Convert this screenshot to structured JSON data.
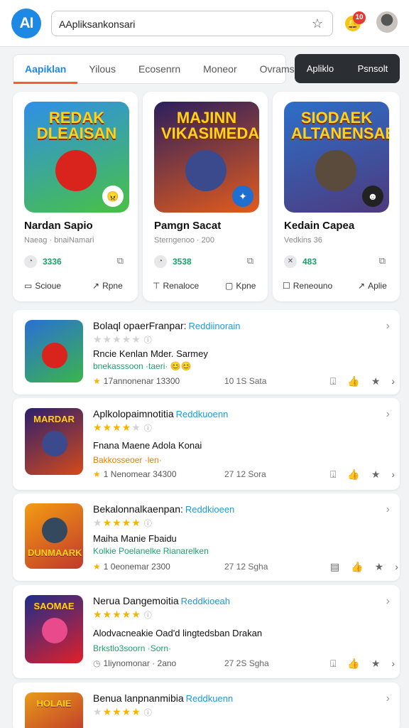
{
  "header": {
    "logo": "AI",
    "search_value": "AApliksankonsari",
    "star_icon": "star-outline-icon",
    "notification_count": "10"
  },
  "tabs": [
    {
      "label": "Aapiklan"
    },
    {
      "label": "Yilous"
    },
    {
      "label": "Ecosenrn"
    },
    {
      "label": "Moneor"
    },
    {
      "label": "Ovrams"
    }
  ],
  "segment": {
    "left": "Apliklo",
    "right": "Psnsolt"
  },
  "featured": [
    {
      "banner": "REDAK DLEAISAN",
      "title": "Nardan Sapio",
      "subtitle": "Naeag  ·  bnaiNamari",
      "stat": "3336",
      "action_left": "Scioue",
      "action_right": "Rpne",
      "colors": {
        "bg1": "#2f8fe8",
        "bg2": "#49c144",
        "hero": "#d9241e"
      }
    },
    {
      "banner": "MAJINN VIKASIMEDAH",
      "title": "Pamgn Sacat",
      "subtitle": "Sterngenoo  ·  200",
      "stat": "3538",
      "action_left": "Renaloce",
      "action_right": "Kpne",
      "colors": {
        "bg1": "#2a1f5e",
        "bg2": "#e35b1c",
        "hero": "#3a4a8c"
      }
    },
    {
      "banner": "SIODAEK ALTANENSAE",
      "title": "Kedain Capea",
      "subtitle": "Vedkins 36",
      "stat": "483",
      "action_left": "Reneouno",
      "action_right": "Aplie",
      "colors": {
        "bg1": "#2c6fc9",
        "bg2": "#4e3a7d",
        "hero": "#5a4b3c"
      }
    }
  ],
  "list": [
    {
      "title": "Bolaql opaerFranpar:",
      "tag": "Reddiinorain",
      "rating": 0,
      "rating_info": "ⓘ",
      "description": "Rncie Kenlan Mder. Sarmey",
      "highlight": "bnekasssoon  ·taeri· 😊😊",
      "highlight_color": "green",
      "meta": "17annonenar  13300",
      "right_meta": "10 1S Sata",
      "thumb_banner": "",
      "colors": {
        "bg1": "#2a6fd6",
        "bg2": "#3bb54a",
        "hero": "#d9241e"
      }
    },
    {
      "title": "Aplkolopaimnotitia",
      "tag": "Reddkuoenn",
      "rating": 4,
      "rating_info": "ⓘ",
      "description": "Fnana Maene Adola Konai",
      "highlight": "Bakkosseoer  ·len·",
      "highlight_color": "orange",
      "meta": "1 Nenomear  34300",
      "right_meta": "27 12 Sora",
      "thumb_banner": "MARDAR",
      "colors": {
        "bg1": "#2c1f6e",
        "bg2": "#d44a1a",
        "hero": "#3a4a8c"
      }
    },
    {
      "title": "Bekalonnalkaenpan:",
      "tag": "Reddkioeen",
      "rating": 4,
      "rating_info": "ⓘ",
      "description": "Maiha Manie Fbaidu",
      "highlight": "Kolkie Poelanelke Rianarelken",
      "highlight_color": "green",
      "meta": "1 0eonemar  2300",
      "right_meta": "27 12 Sgha",
      "thumb_banner": "DUNMAARK",
      "colors": {
        "bg1": "#f39c12",
        "bg2": "#c0392b",
        "hero": "#34495e"
      }
    },
    {
      "title": "Nerua Dangemoitia",
      "tag": "Reddkioeah",
      "rating": 5,
      "rating_info": "ⓘ",
      "description": "Alodvacneakie Oad'd lingtedsban Drakan",
      "highlight": "Brkstlo3soorn  ·Sorn·",
      "highlight_color": "green",
      "meta": "1liynomonar  ·  2ano",
      "right_meta": "27 2S Sgha",
      "thumb_banner": "SAOMAE",
      "colors": {
        "bg1": "#1d2d8c",
        "bg2": "#e0202a",
        "hero": "#e84a8c"
      }
    },
    {
      "title": "Benua lanpnanmibia",
      "tag": "Reddkuenn",
      "rating": 4,
      "rating_info": "ⓘ",
      "description": "",
      "highlight": "",
      "highlight_color": "green",
      "meta": "",
      "right_meta": "",
      "thumb_banner": "HOLAIE",
      "colors": {
        "bg1": "#e89b1a",
        "bg2": "#c0392b",
        "hero": "#2a3b8f"
      }
    }
  ]
}
